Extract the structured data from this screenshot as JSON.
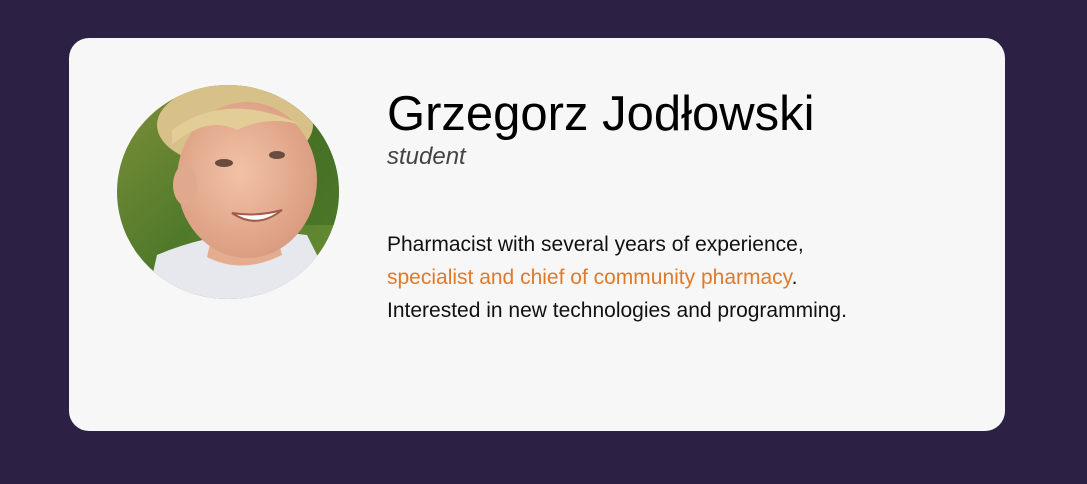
{
  "profile": {
    "name": "Grzegorz Jodłowski",
    "role": "student",
    "bio": {
      "line1": "Pharmacist with several years of experience,",
      "highlight": "specialist and chief of community pharmacy",
      "highlight_suffix": ".",
      "line3": "Interested in new technologies and programming."
    }
  },
  "colors": {
    "background": "#2d2045",
    "card": "#f7f7f7",
    "highlight": "#e07a2b"
  }
}
